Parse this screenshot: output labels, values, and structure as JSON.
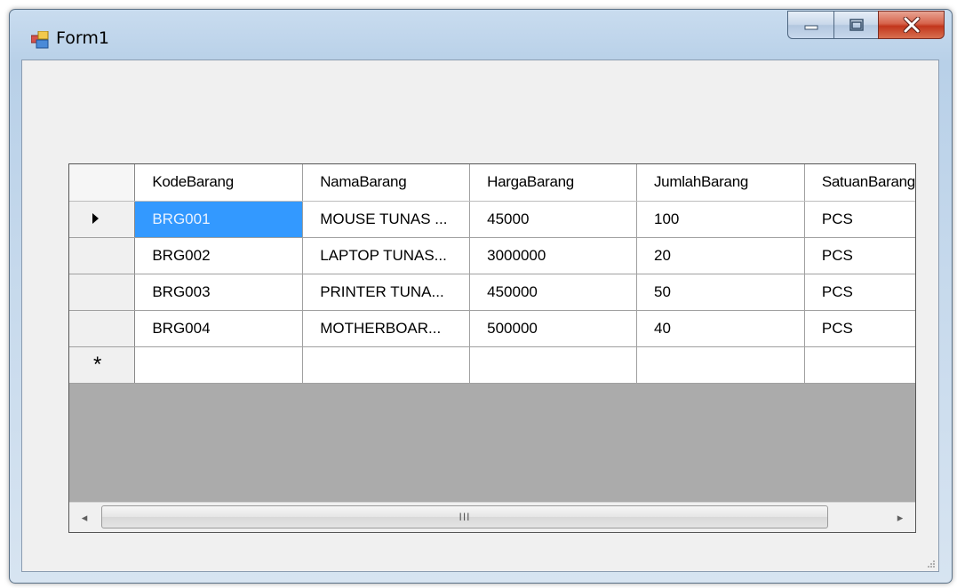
{
  "window": {
    "title": "Form1",
    "app_icon": "winforms-form-icon",
    "buttons": {
      "minimize": "minimize-icon",
      "maximize": "maximize-icon",
      "close": "close-icon"
    }
  },
  "grid": {
    "columns": [
      "KodeBarang",
      "NamaBarang",
      "HargaBarang",
      "JumlahBarang",
      "SatuanBarang"
    ],
    "rows": [
      [
        "BRG001",
        "MOUSE TUNAS ...",
        "45000",
        "100",
        "PCS"
      ],
      [
        "BRG002",
        "LAPTOP TUNAS...",
        "3000000",
        "20",
        "PCS"
      ],
      [
        "BRG003",
        "PRINTER TUNA...",
        "450000",
        "50",
        "PCS"
      ],
      [
        "BRG004",
        "MOTHERBOAR...",
        "500000",
        "40",
        "PCS"
      ]
    ],
    "current_row_marker": "▶",
    "new_row_marker": "*",
    "selected_cell_color": "#3399ff",
    "scrollbar": {
      "left_arrow": "◂",
      "right_arrow": "▸",
      "grip": "III"
    }
  },
  "colors": {
    "close_button": "#c2361c",
    "client_bg": "#f0f0f0",
    "grid_bg": "#ababab"
  }
}
